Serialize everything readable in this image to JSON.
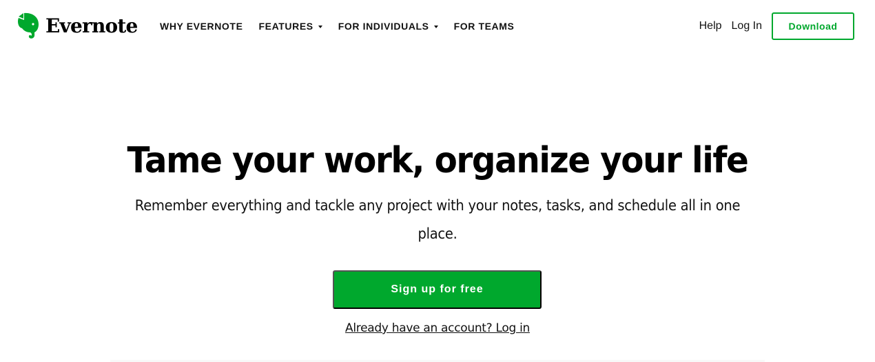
{
  "brand": {
    "name": "Evernote",
    "logo_icon": "elephant-icon",
    "color": "#00a82d"
  },
  "nav": {
    "items": [
      {
        "label": "WHY EVERNOTE",
        "has_dropdown": false
      },
      {
        "label": "FEATURES",
        "has_dropdown": true
      },
      {
        "label": "FOR INDIVIDUALS",
        "has_dropdown": true
      },
      {
        "label": "FOR TEAMS",
        "has_dropdown": false
      }
    ]
  },
  "header_right": {
    "help_label": "Help",
    "login_label": "Log In",
    "download_label": "Download"
  },
  "hero": {
    "title": "Tame your work, organize your life",
    "subtitle": "Remember everything and tackle any project with your notes, tasks, and schedule all in one place.",
    "cta_label": "Sign up for free",
    "login_prompt": "Already have an account? Log in"
  }
}
